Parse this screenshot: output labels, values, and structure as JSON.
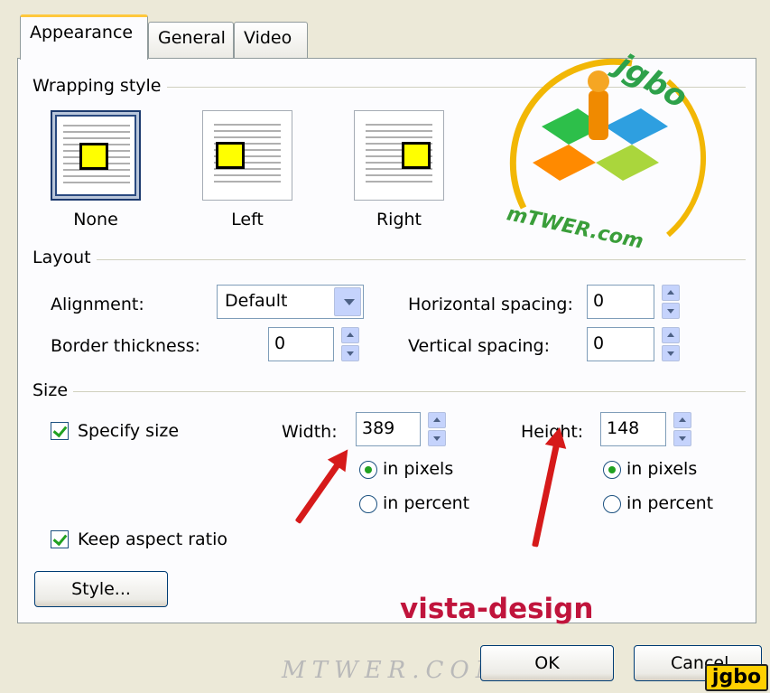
{
  "tabs": [
    "Appearance",
    "General",
    "Video"
  ],
  "wrapping": {
    "title": "Wrapping style",
    "options": [
      "None",
      "Left",
      "Right"
    ],
    "selected": "None"
  },
  "layout": {
    "title": "Layout",
    "alignment_label": "Alignment:",
    "alignment_value": "Default",
    "border_label": "Border thickness:",
    "border_value": "0",
    "hspacing_label": "Horizontal spacing:",
    "hspacing_value": "0",
    "vspacing_label": "Vertical spacing:",
    "vspacing_value": "0"
  },
  "size": {
    "title": "Size",
    "specify_label": "Specify size",
    "specify_checked": true,
    "width_label": "Width:",
    "width_value": "389",
    "height_label": "Height:",
    "height_value": "148",
    "in_pixels": "in pixels",
    "in_percent": "in percent",
    "keep_aspect_label": "Keep aspect ratio",
    "keep_aspect_checked": true
  },
  "buttons": {
    "style": "Style...",
    "ok": "OK",
    "cancel": "Cancel"
  },
  "overlays": {
    "vista_text": "vista-design",
    "mtwer_text": "MTWER.COM",
    "logo_text": "jgbo",
    "logo_sub": "mTWER.com",
    "corner_logo": "jgbo",
    "vista_color": "#c0143c",
    "mtwer_color": "#b9b9b9"
  }
}
